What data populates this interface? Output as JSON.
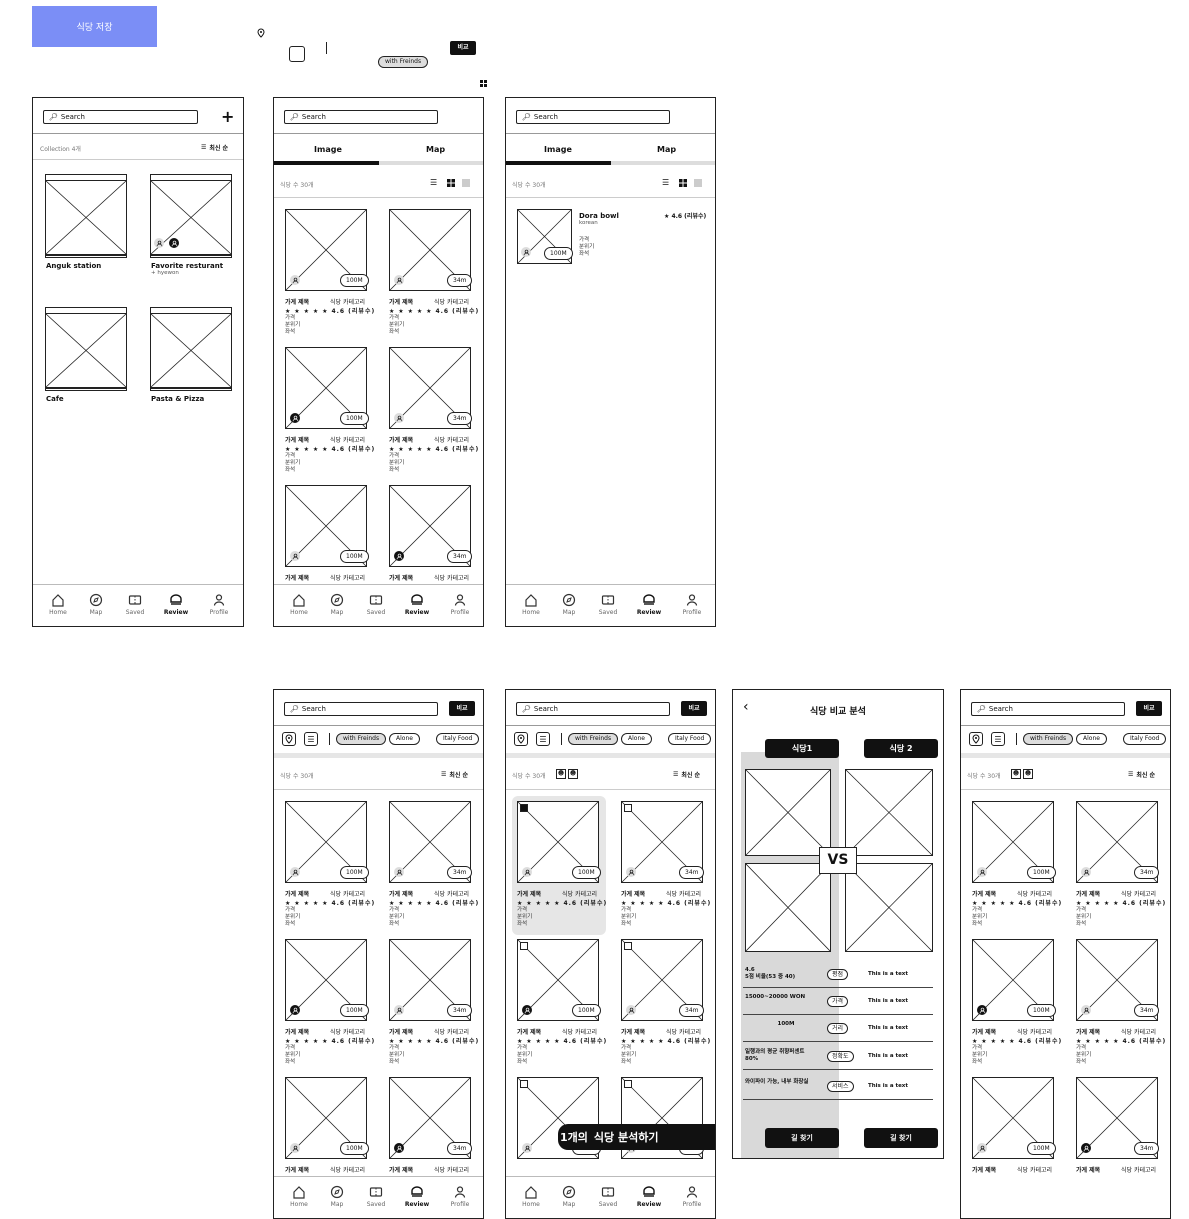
{
  "top": {
    "save_button": "식당 저장",
    "compare_badge": "비교",
    "with_friends": "with Freinds"
  },
  "nav": [
    "Home",
    "Map",
    "Saved",
    "Review",
    "Profile"
  ],
  "screen1": {
    "search_placeholder": "Search",
    "collection_count": "Collection 4개",
    "sort": "최신 순",
    "collections": [
      {
        "name": "Anguk station",
        "sub": ""
      },
      {
        "name": "Favorite resturant",
        "sub": "+ hyewon"
      },
      {
        "name": "Cafe",
        "sub": ""
      },
      {
        "name": "Pasta & Pizza",
        "sub": ""
      }
    ]
  },
  "tabs": {
    "image": "Image",
    "map": "Map"
  },
  "count_label": "식당 수  30개",
  "card": {
    "title": "가게 제목",
    "category": "식당 카테고리",
    "stars": "★ ★ ★ ★ ★",
    "rating": "4.6 (리뷰수)",
    "meta1": "가격",
    "meta2": "분위기",
    "meta3": "좌석",
    "dist_a": "100M",
    "dist_b": "34m"
  },
  "screen3": {
    "name": "Dora bowl",
    "cat": "korean",
    "rating": "4.6 (리뷰수)",
    "meta1": "가격",
    "meta2": "분위기",
    "meta3": "좌석",
    "dist": "100M"
  },
  "filters": {
    "compare_btn": "비교",
    "chips": [
      "with Freinds",
      "Alone",
      "Italy Food"
    ],
    "sort": "최신 순"
  },
  "selection_bar": {
    "count": "1개의",
    "action": "식당 분석하기"
  },
  "compare": {
    "title": "식당 비교 분석",
    "left": "식당1",
    "right": "식당 2",
    "vs": "VS",
    "rows": [
      {
        "left": "4.6\n5점 비율(53 중 40)",
        "label": "평점",
        "right": "This is a text"
      },
      {
        "left": "15000~20000 WON",
        "label": "가격",
        "right": "This is a text"
      },
      {
        "left": "100M",
        "label": "거리",
        "right": "This is a text"
      },
      {
        "left": "일행과의 평균 취향퍼센트\n80%",
        "label": "정확도",
        "right": "This is a text"
      },
      {
        "left": "와이파이 가능, 내부 화장실",
        "label": "서비스",
        "right": "This is a text"
      }
    ],
    "route": "길 찾기"
  }
}
